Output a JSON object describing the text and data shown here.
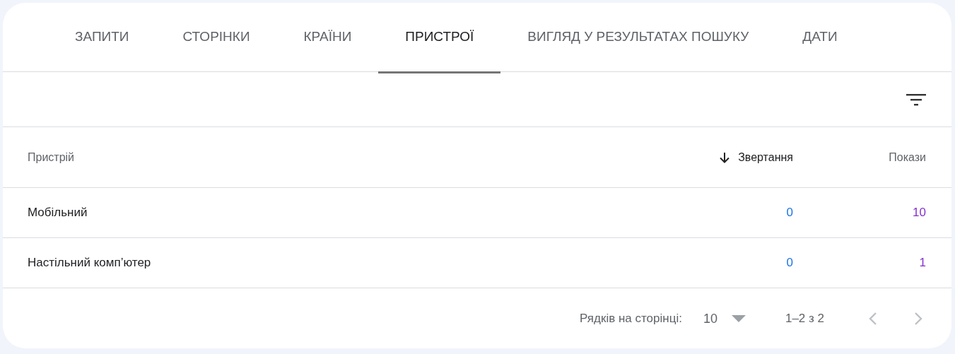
{
  "tabs": [
    {
      "label": "ЗАПИТИ",
      "selected": false
    },
    {
      "label": "СТОРІНКИ",
      "selected": false
    },
    {
      "label": "КРАЇНИ",
      "selected": false
    },
    {
      "label": "ПРИСТРОЇ",
      "selected": true
    },
    {
      "label": "ВИГЛЯД У РЕЗУЛЬТАТАХ ПОШУКУ",
      "selected": false
    },
    {
      "label": "ДАТИ",
      "selected": false
    }
  ],
  "table": {
    "columns": [
      {
        "label": "Пристрій",
        "sorted": false,
        "color": "#202124"
      },
      {
        "label": "Звертання",
        "sorted": true,
        "color": "#1a73e8"
      },
      {
        "label": "Покази",
        "sorted": false,
        "color": "#8430ce"
      }
    ],
    "rows": [
      [
        "Мобільний",
        "0",
        "10"
      ],
      [
        "Настільний комп’ютер",
        "0",
        "1"
      ]
    ]
  },
  "pagination": {
    "rows_label": "Рядків на сторінці:",
    "rows_per_page": "10",
    "range": "1–2 з 2",
    "prev_disabled": true,
    "next_disabled": true
  }
}
